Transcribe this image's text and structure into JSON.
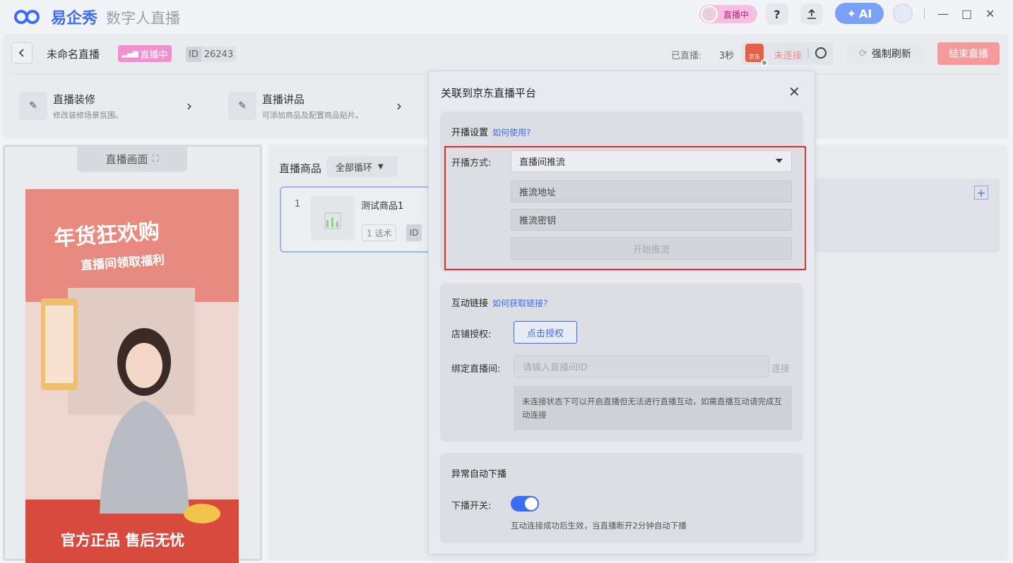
{
  "titlebar": {
    "logo_text": "易企秀",
    "app_name": "数字人直播",
    "live_pill": "直播中",
    "help": "?",
    "ai_label": "AI",
    "min": "—",
    "max": "□",
    "close": "✕"
  },
  "header": {
    "title": "未命名直播",
    "live_tag": "直播中",
    "id_label": "ID",
    "id_value": "26243",
    "aired_label": "已直播:",
    "aired_value": "3秒",
    "jd_label": "京东",
    "status": "未连接",
    "status_sep": "|",
    "refresh": "强制刷新",
    "end": "结束直播"
  },
  "tools": [
    {
      "title": "直播装修",
      "desc": "修改装修场景氛围。"
    },
    {
      "title": "直播讲品",
      "desc": "可添加商品及配置商品贴片。"
    }
  ],
  "preview": {
    "tab": "直播画面",
    "headline": "年货狂欢购",
    "sub": "直播间领取福利",
    "bottom": "官方正品 售后无忧"
  },
  "goods": {
    "title": "直播商品",
    "loop": "全部循环",
    "item_index": "1",
    "item_name": "测试商品1",
    "item_scripts": "1 话术",
    "item_id": "ID"
  },
  "modal": {
    "title": "关联到京东直播平台",
    "section1": {
      "title": "开播设置",
      "help": "如何使用?",
      "mode_label": "开播方式:",
      "mode_value": "直播间推流",
      "push_url": "推流地址",
      "push_key": "推流密钥",
      "start": "开始推流"
    },
    "section2": {
      "title": "互动链接",
      "help": "如何获取链接?",
      "auth_label": "店铺授权:",
      "auth_button": "点击授权",
      "room_label": "绑定直播间:",
      "room_placeholder": "请输入直播间ID",
      "connect": "连接",
      "note": "未连接状态下可以开启直播但无法进行直播互动，如需直播互动请完成互动连接"
    },
    "section3": {
      "title": "异常自动下播",
      "switch_label": "下播开关:",
      "switch_desc": "互动连接成功后生效，当直播断开2分钟自动下播"
    }
  },
  "colors": {
    "accent": "#3b6cf6",
    "danger": "#e52b2b",
    "live": "#f28fd0"
  }
}
